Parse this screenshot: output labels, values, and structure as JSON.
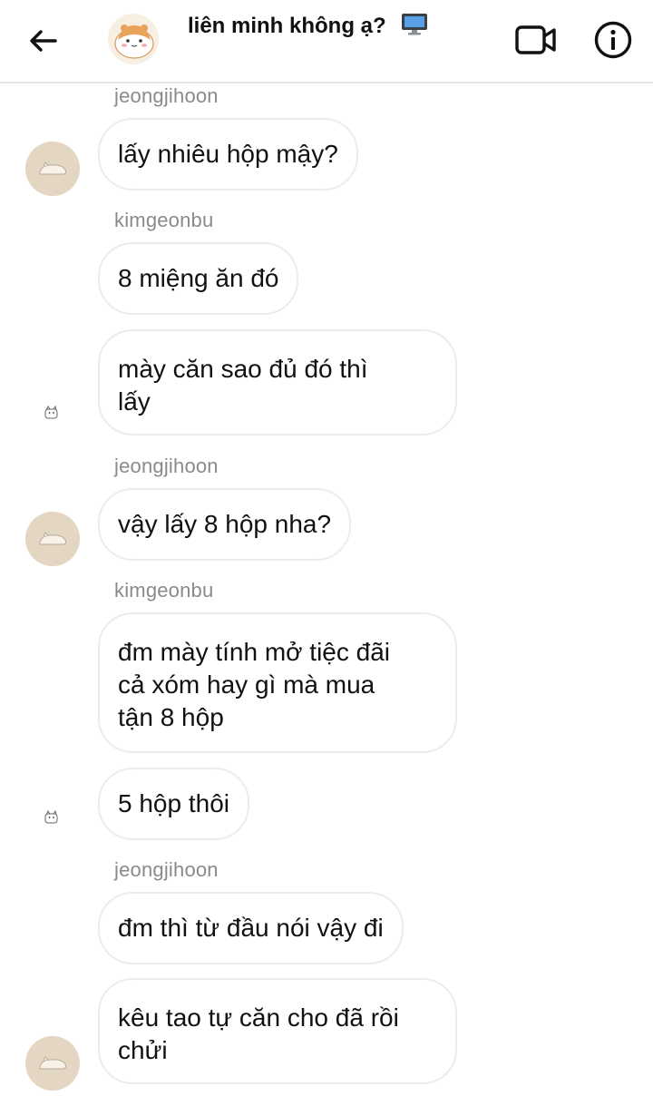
{
  "header": {
    "group_name": "liên minh không ạ?",
    "back_icon": "arrow-left-icon",
    "video_icon": "video-call-icon",
    "info_icon": "info-icon"
  },
  "messages": [
    {
      "sender": "jeongjihoon",
      "text": "lấy nhiêu hộp mậy?"
    },
    {
      "sender": "kimgeonbu",
      "text": "8 miệng ăn đó"
    },
    {
      "sender": "kimgeonbu",
      "text_lines": [
        "mày căn sao đủ đó thì",
        "lấy"
      ]
    },
    {
      "sender": "jeongjihoon",
      "text": "vậy lấy 8 hộp nha?"
    },
    {
      "sender": "kimgeonbu",
      "text_lines": [
        "đm mày tính mở tiệc đãi",
        "cả xóm hay gì mà mua",
        "tận 8 hộp"
      ]
    },
    {
      "sender": "kimgeonbu",
      "text": "5 hộp thôi"
    },
    {
      "sender": "jeongjihoon",
      "text": "đm thì từ đầu nói vậy đi"
    },
    {
      "sender": "jeongjihoon",
      "text_lines": [
        "kêu tao tự căn cho đã rồi",
        "chửi"
      ]
    }
  ],
  "colors": {
    "sender_name": "#8a8a8a",
    "bubble_border": "#ececec",
    "avatar_bg": "#e3d6c3"
  }
}
